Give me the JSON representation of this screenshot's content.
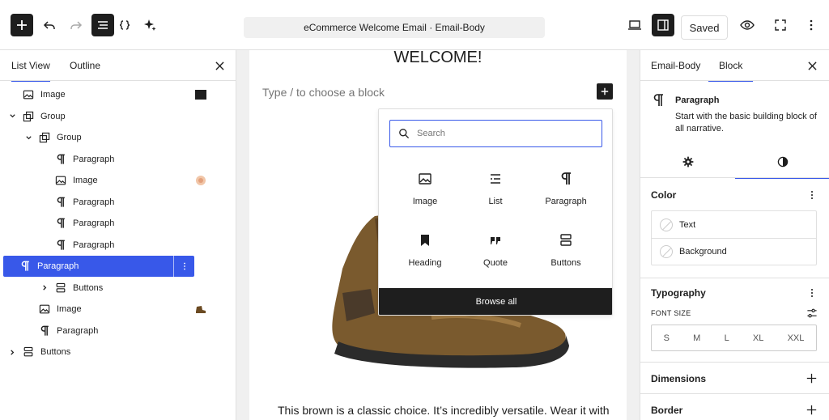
{
  "topbar": {
    "doc_title": "eCommerce Welcome Email · Email-Body",
    "saved_label": "Saved"
  },
  "left_panel": {
    "tabs": [
      "List View",
      "Outline"
    ],
    "tree": [
      {
        "label": "Image",
        "icon": "image-icon",
        "depth": 0,
        "chevron": "",
        "thumb": "dark"
      },
      {
        "label": "Group",
        "icon": "group-icon",
        "depth": 0,
        "chevron": "down",
        "thumb": ""
      },
      {
        "label": "Group",
        "icon": "group-icon",
        "depth": 1,
        "chevron": "down",
        "thumb": ""
      },
      {
        "label": "Paragraph",
        "icon": "paragraph-icon",
        "depth": 2,
        "chevron": "",
        "thumb": ""
      },
      {
        "label": "Image",
        "icon": "image-icon",
        "depth": 2,
        "chevron": "",
        "thumb": "light"
      },
      {
        "label": "Paragraph",
        "icon": "paragraph-icon",
        "depth": 2,
        "chevron": "",
        "thumb": ""
      },
      {
        "label": "Paragraph",
        "icon": "paragraph-icon",
        "depth": 2,
        "chevron": "",
        "thumb": ""
      },
      {
        "label": "Paragraph",
        "icon": "paragraph-icon",
        "depth": 2,
        "chevron": "",
        "thumb": ""
      },
      {
        "label": "Paragraph",
        "icon": "paragraph-icon",
        "depth": 2,
        "chevron": "",
        "thumb": "",
        "selected": true
      },
      {
        "label": "Buttons",
        "icon": "buttons-icon",
        "depth": 2,
        "chevron": "right",
        "thumb": ""
      },
      {
        "label": "Image",
        "icon": "image-icon",
        "depth": 1,
        "chevron": "",
        "thumb": "boot"
      },
      {
        "label": "Paragraph",
        "icon": "paragraph-icon",
        "depth": 1,
        "chevron": "",
        "thumb": ""
      },
      {
        "label": "Buttons",
        "icon": "buttons-icon",
        "depth": 0,
        "chevron": "right",
        "thumb": ""
      }
    ]
  },
  "canvas": {
    "heading": "WELCOME!",
    "placeholder": "Type / to choose a block",
    "body_text": "This brown is a classic choice. It’s incredibly versatile. Wear it with"
  },
  "inserter": {
    "search_placeholder": "Search",
    "blocks": [
      {
        "label": "Image",
        "icon": "image-icon"
      },
      {
        "label": "List",
        "icon": "list-icon"
      },
      {
        "label": "Paragraph",
        "icon": "paragraph-icon"
      },
      {
        "label": "Heading",
        "icon": "heading-bookmark-icon"
      },
      {
        "label": "Quote",
        "icon": "quote-icon"
      },
      {
        "label": "Buttons",
        "icon": "buttons-icon"
      }
    ],
    "browse_all": "Browse all"
  },
  "right_panel": {
    "tabs": [
      "Email-Body",
      "Block"
    ],
    "block_name": "Paragraph",
    "block_desc": "Start with the basic building block of all narrative.",
    "color_title": "Color",
    "color_items": [
      "Text",
      "Background"
    ],
    "typography_title": "Typography",
    "font_size_label": "FONT SIZE",
    "font_sizes": [
      "S",
      "M",
      "L",
      "XL",
      "XXL"
    ],
    "dimensions_title": "Dimensions",
    "border_title": "Border"
  },
  "colors": {
    "accent": "#3858e9",
    "dark": "#1e1e1e"
  }
}
